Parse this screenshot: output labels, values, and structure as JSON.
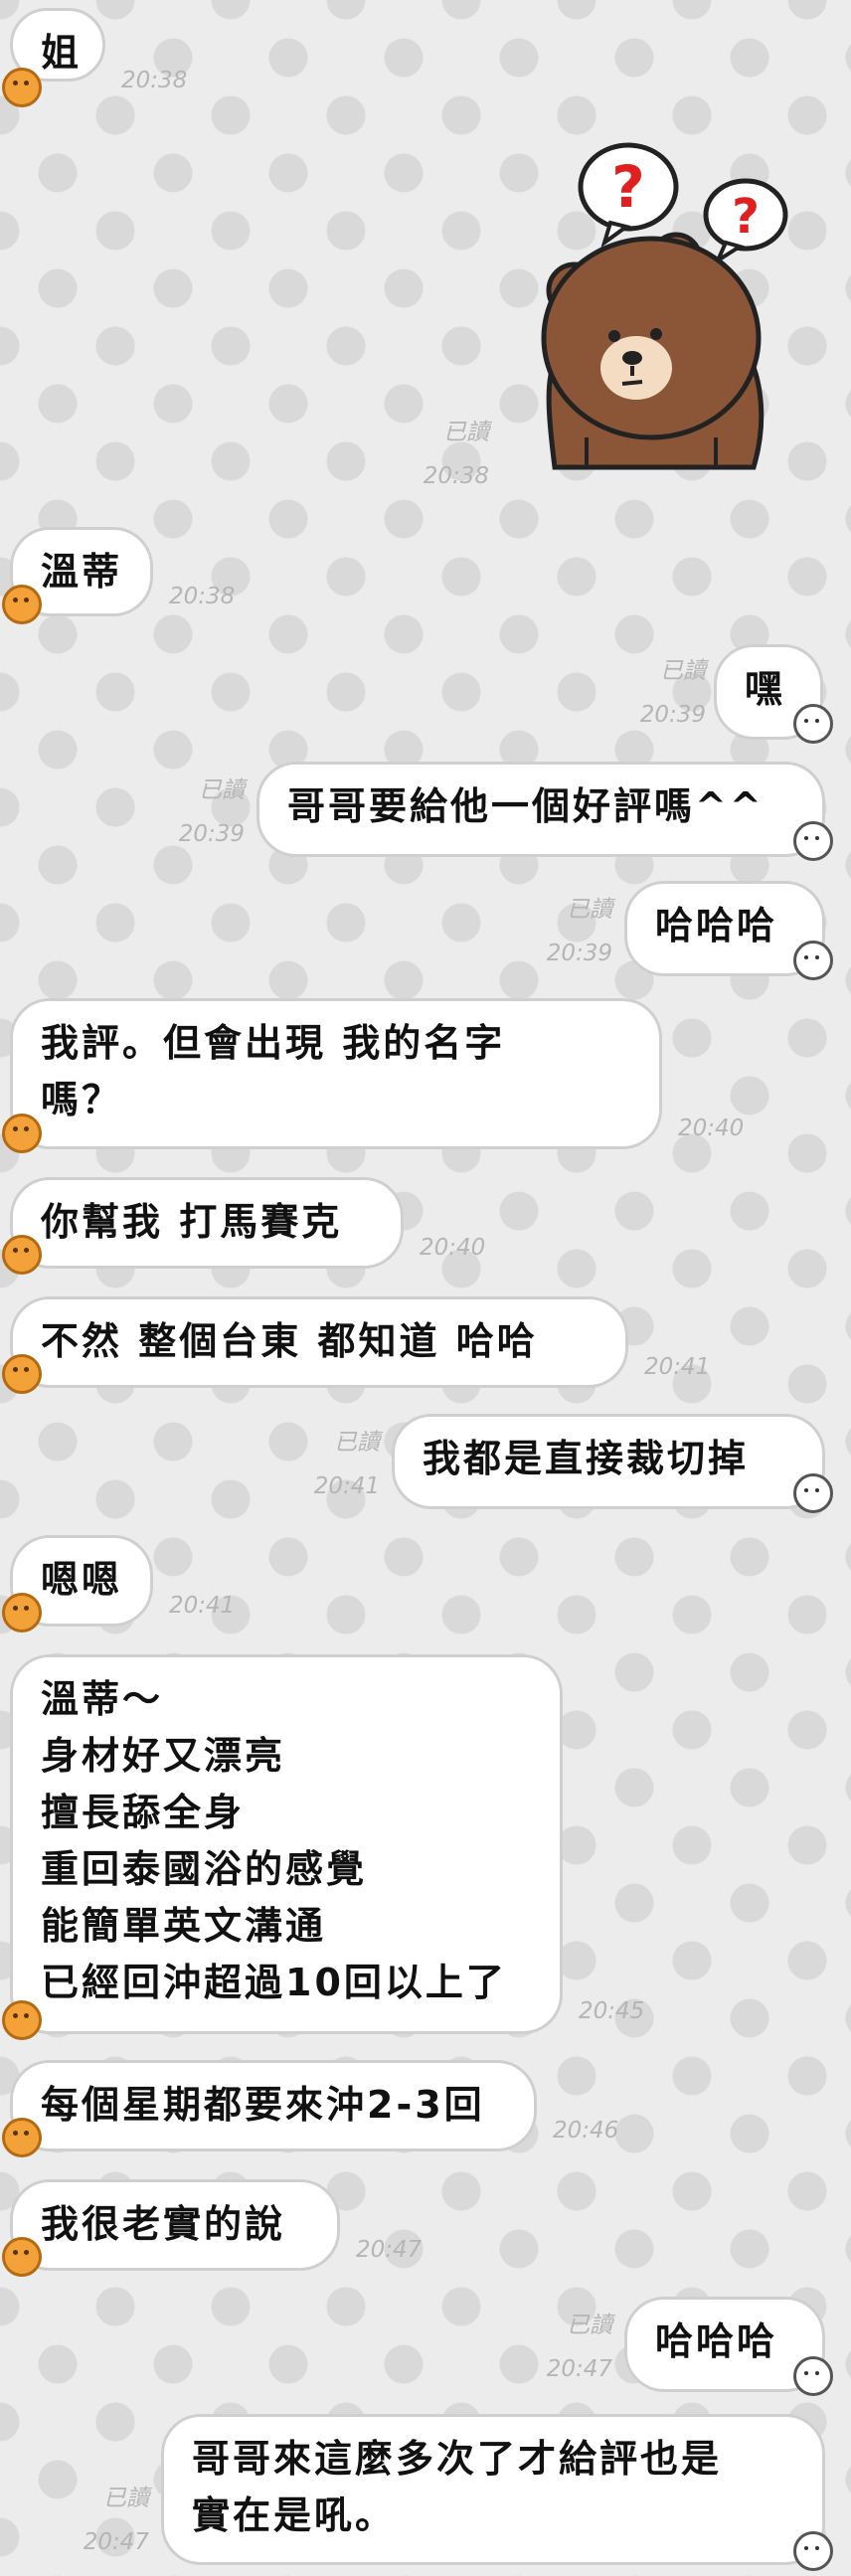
{
  "messages": [
    {
      "id": "m1",
      "side": "in",
      "text": "姐",
      "time": "20:38"
    },
    {
      "id": "m2",
      "side": "out",
      "type": "sticker",
      "sticker": "confused-bear-sticker",
      "read": "已讀",
      "time": "20:38"
    },
    {
      "id": "m3",
      "side": "in",
      "text": "溫蒂",
      "time": "20:38"
    },
    {
      "id": "m4",
      "side": "out",
      "text": "嘿",
      "read": "已讀",
      "time": "20:39"
    },
    {
      "id": "m5",
      "side": "out",
      "text": "哥哥要給他一個好評嗎^^",
      "read": "已讀",
      "time": "20:39"
    },
    {
      "id": "m6",
      "side": "out",
      "text": "哈哈哈",
      "read": "已讀",
      "time": "20:39"
    },
    {
      "id": "m7",
      "side": "in",
      "text": "我評。但會出現 我的名字\n嗎？",
      "time": "20:40"
    },
    {
      "id": "m8",
      "side": "in",
      "text": "你幫我 打馬賽克",
      "time": "20:40"
    },
    {
      "id": "m9",
      "side": "in",
      "text": "不然 整個台東 都知道 哈哈",
      "time": "20:41"
    },
    {
      "id": "m10",
      "side": "out",
      "text": "我都是直接裁切掉",
      "read": "已讀",
      "time": "20:41"
    },
    {
      "id": "m11",
      "side": "in",
      "text": "嗯嗯",
      "time": "20:41"
    },
    {
      "id": "m12",
      "side": "in",
      "text": "溫蒂～\n身材好又漂亮\n擅長舔全身\n重回泰國浴的感覺\n能簡單英文溝通\n已經回沖超過10回以上了",
      "time": "20:45"
    },
    {
      "id": "m13",
      "side": "in",
      "text": "每個星期都要來沖2-3回",
      "time": "20:46"
    },
    {
      "id": "m14",
      "side": "in",
      "text": "我很老實的說",
      "time": "20:47"
    },
    {
      "id": "m15",
      "side": "out",
      "text": "哈哈哈",
      "read": "已讀",
      "time": "20:47"
    },
    {
      "id": "m16",
      "side": "out",
      "text": "哥哥來這麼多次了才給評也是\n實在是吼。",
      "read": "已讀",
      "time": "20:47"
    }
  ],
  "colors": {
    "background": "#ececec",
    "bubble": "#ffffff",
    "bubble_border": "#cfcfcf",
    "meta_text": "#b5b5b5",
    "incoming_avatar": "#f3a23a",
    "sticker_bear": "#8b5637",
    "sticker_question": "#e02020"
  }
}
